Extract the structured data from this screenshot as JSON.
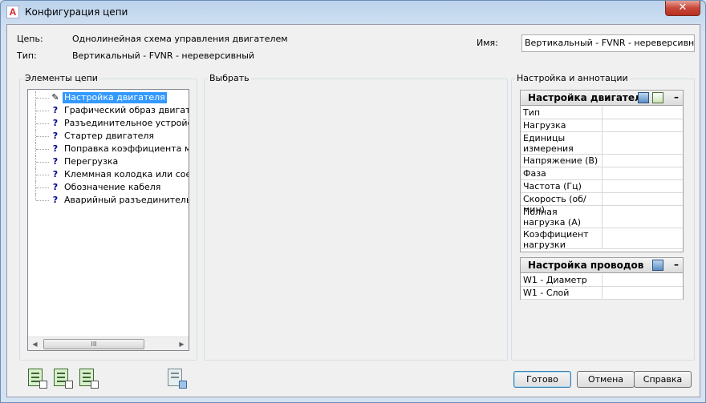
{
  "window": {
    "title": "Конфигурация цепи",
    "close_label": "✕",
    "app_letter": "A"
  },
  "header": {
    "circuit_label": "Цепь:",
    "circuit_value": "Однолинейная схема управления двигателем",
    "type_label": "Тип:",
    "type_value": "Вертикальный - FVNR - нереверсивный",
    "name_label": "Имя:",
    "name_value": "Вертикальный - FVNR - нереверсивный (I"
  },
  "groups": {
    "elements_title": "Элементы цепи",
    "select_title": "Выбрать",
    "settings_title": "Настройка и аннотации"
  },
  "tree": {
    "items": [
      {
        "label": "Настройка двигателя",
        "icon": "pencil-icon",
        "glyph": "✎",
        "selected": true
      },
      {
        "label": "Графический образ двигателя",
        "icon": "question-icon",
        "glyph": "?"
      },
      {
        "label": "Разъединительное устройство",
        "icon": "question-icon",
        "glyph": "?"
      },
      {
        "label": "Стартер двигателя",
        "icon": "question-icon",
        "glyph": "?"
      },
      {
        "label": "Поправка коэффициента мощн",
        "icon": "question-icon",
        "glyph": "?"
      },
      {
        "label": "Перегрузка",
        "icon": "question-icon",
        "glyph": "?"
      },
      {
        "label": "Клеммная колодка или соедин",
        "icon": "question-icon",
        "glyph": "?"
      },
      {
        "label": "Обозначение кабеля",
        "icon": "question-icon",
        "glyph": "?"
      },
      {
        "label": "Аварийный разъединитель по",
        "icon": "question-icon",
        "glyph": "?"
      }
    ],
    "scroll_left": "◀",
    "scroll_right": "▶",
    "scroll_grip": "III"
  },
  "motor_panel": {
    "title": "Настройка двигателя",
    "minimize": "–",
    "rows": [
      {
        "key": "Тип"
      },
      {
        "key": "Нагрузка"
      },
      {
        "key": "Единицы измерения"
      },
      {
        "key": "Напряжение (В)"
      },
      {
        "key": "Фаза"
      },
      {
        "key": "Частота (Гц)"
      },
      {
        "key": "Скорость (об/мин)"
      },
      {
        "key": "Полная нагрузка (А)"
      },
      {
        "key": "Коэффициент нагрузки"
      }
    ]
  },
  "wire_panel": {
    "title": "Настройка проводов",
    "minimize": "–",
    "rows": [
      {
        "key": "W1 - Диаметр"
      },
      {
        "key": "W1 - Слой"
      }
    ]
  },
  "buttons": {
    "ok": "Готово",
    "cancel": "Отмена",
    "help": "Справка"
  }
}
